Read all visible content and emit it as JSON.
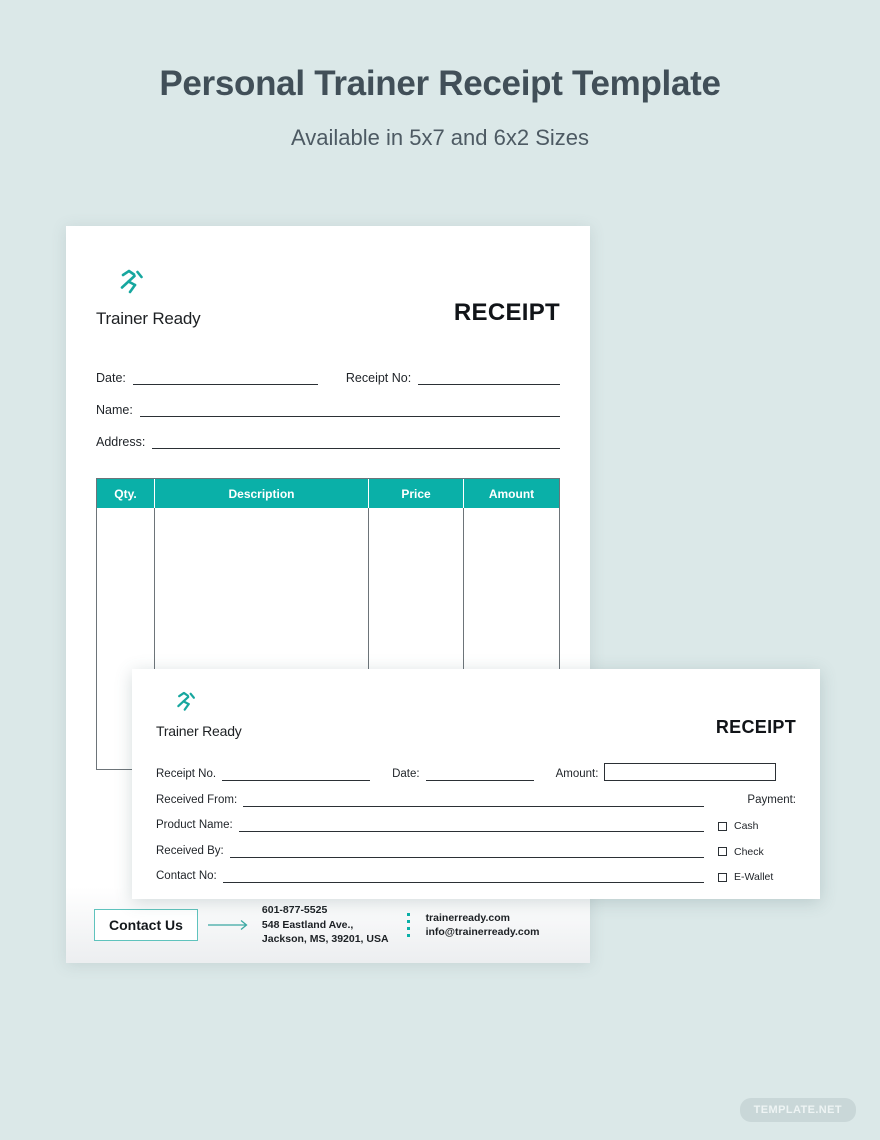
{
  "page": {
    "title": "Personal Trainer Receipt Template",
    "subtitle": "Available in 5x7 and 6x2 Sizes",
    "background_color": "#dbe8e8",
    "accent_color": "#0ab0a8",
    "title_color": "#414f58"
  },
  "brand": {
    "name": "Trainer Ready",
    "logo_icon": "running-person-icon",
    "logo_color": "#0ab0a8"
  },
  "receipt_portrait": {
    "size_label": "5x7",
    "heading": "RECEIPT",
    "fields": [
      {
        "label": "Date:",
        "value": ""
      },
      {
        "label": "Receipt No:",
        "value": ""
      },
      {
        "label": "Name:",
        "value": ""
      },
      {
        "label": "Address:",
        "value": ""
      }
    ],
    "table": {
      "headers": [
        "Qty.",
        "Description",
        "Price",
        "Amount"
      ],
      "rows": []
    },
    "footer": {
      "contact_button": "Contact Us",
      "phone": "601-877-5525",
      "address_line1": "548 Eastland Ave.,",
      "address_line2": "Jackson, MS, 39201, USA",
      "website": "trainerready.com",
      "email": "info@trainerready.com"
    }
  },
  "receipt_landscape": {
    "size_label": "6x2",
    "heading": "RECEIPT",
    "fields": [
      {
        "label": "Receipt No.",
        "value": ""
      },
      {
        "label": "Date:",
        "value": ""
      },
      {
        "label": "Amount:",
        "value": ""
      },
      {
        "label": "Received From:",
        "value": ""
      },
      {
        "label": "Product Name:",
        "value": ""
      },
      {
        "label": "Received By:",
        "value": ""
      },
      {
        "label": "Contact No:",
        "value": ""
      }
    ],
    "payment": {
      "label": "Payment:",
      "options": [
        "Cash",
        "Check",
        "E-Wallet"
      ]
    }
  },
  "watermark": {
    "text": "TEMPLATE.NET"
  }
}
